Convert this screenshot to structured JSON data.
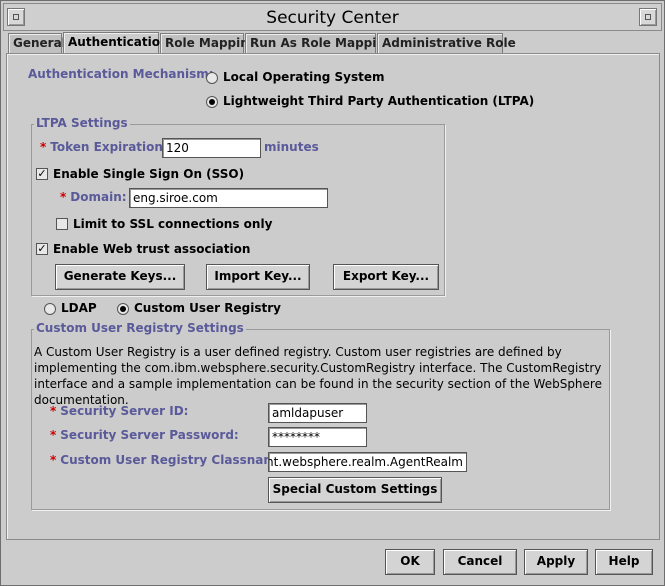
{
  "window": {
    "title": "Security Center"
  },
  "tabs": [
    {
      "label": "General"
    },
    {
      "label": "Authentication"
    },
    {
      "label": "Role Mapping"
    },
    {
      "label": "Run As Role Mapping"
    },
    {
      "label": "Administrative Role"
    }
  ],
  "auth": {
    "mechanism_label": "Authentication Mechanism:",
    "options": [
      {
        "label": "Local Operating System",
        "selected": false
      },
      {
        "label": "Lightweight Third Party Authentication (LTPA)",
        "selected": true
      }
    ]
  },
  "ltpa": {
    "legend": "LTPA Settings",
    "token_label": "Token Expiration:",
    "token_value": "120",
    "token_unit": "minutes",
    "sso_label": "Enable Single Sign On (SSO)",
    "sso_checked": true,
    "domain_label": "Domain:",
    "domain_value": "eng.siroe.com",
    "ssl_label": "Limit to SSL connections only",
    "ssl_checked": false,
    "trust_label": "Enable Web trust association",
    "trust_checked": true,
    "generate_keys": "Generate Keys...",
    "import_key": "Import Key...",
    "export_key": "Export Key..."
  },
  "registry_choice": {
    "ldap": "LDAP",
    "custom": "Custom User Registry",
    "selected": "custom"
  },
  "custom_registry": {
    "legend": "Custom User Registry Settings",
    "description": "A Custom User Registry is a user defined registry. Custom user registries are defined by implementing the com.ibm.websphere.security.CustomRegistry interface. The CustomRegistry interface and a sample implementation can be found in the security section of the WebSphere documentation.",
    "server_id_label": "Security Server ID:",
    "server_id_value": "amldapuser",
    "password_label": "Security Server Password:",
    "password_value": "********",
    "classname_label": "Custom User Registry Classname",
    "classname_value": "agent.websphere.realm.AgentRealm",
    "special_button": "Special Custom Settings"
  },
  "footer": {
    "ok": "OK",
    "cancel": "Cancel",
    "apply": "Apply",
    "help": "Help"
  }
}
